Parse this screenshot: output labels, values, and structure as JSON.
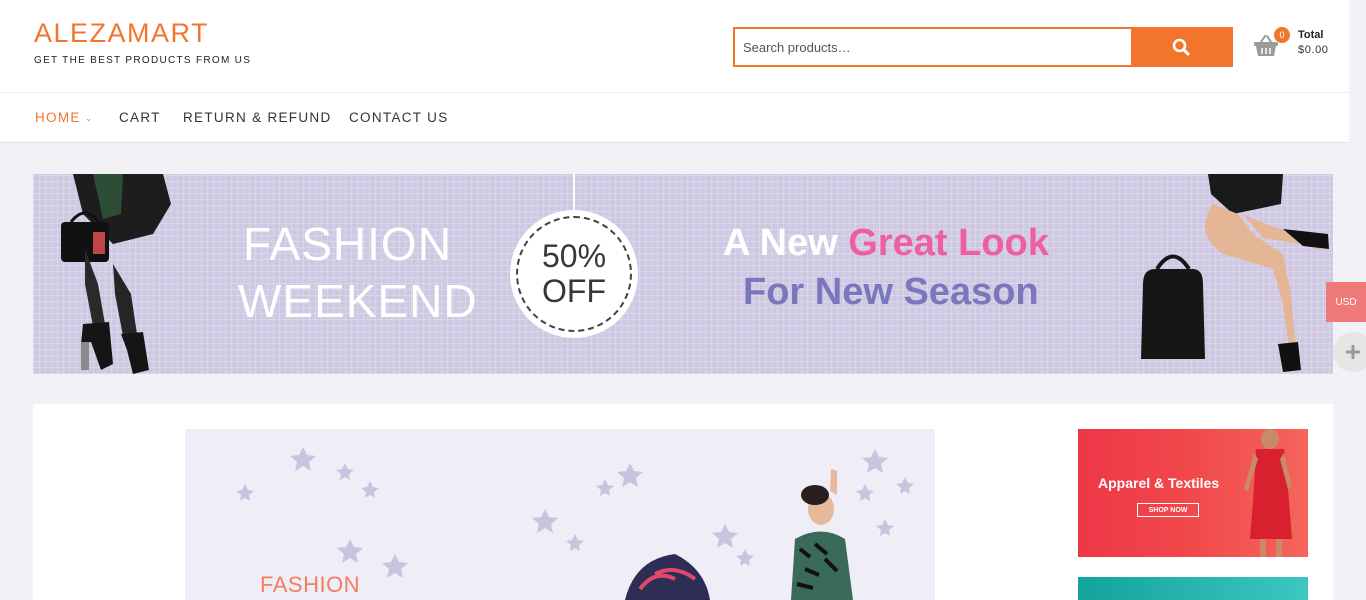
{
  "header": {
    "logo": "ALEZAMART",
    "tagline": "GET THE BEST PRODUCTS FROM US",
    "search": {
      "placeholder": "Search products…"
    },
    "cart": {
      "count": "0",
      "total_label": "Total",
      "total_value": "$0.00"
    }
  },
  "nav": {
    "items": [
      {
        "label": "HOME",
        "active": true
      },
      {
        "label": "CART"
      },
      {
        "label": "RETURN & REFUND"
      },
      {
        "label": "CONTACT US"
      }
    ]
  },
  "hero": {
    "left_line1": "FASHION",
    "left_line2": "WEEKEND",
    "badge_pct": "50%",
    "badge_off": "OFF",
    "headline_part1": "A New ",
    "headline_part2": "Great Look",
    "headline_line2": "For New Season"
  },
  "side": {
    "currency": "USD"
  },
  "content": {
    "slider_text": "FASHION",
    "promo1_title": "Apparel & Textiles",
    "promo1_button": "SHOP NOW"
  },
  "colors": {
    "accent": "#f2752c",
    "hero_bg": "#cfc8e3",
    "pink": "#ec5fa3",
    "purple": "#7b77bd",
    "promo_red": "#ef3f48",
    "promo_teal": "#13a39c"
  },
  "icons": [
    "search-icon",
    "cart-basket-icon",
    "chevron-down-icon",
    "plus-icon"
  ]
}
